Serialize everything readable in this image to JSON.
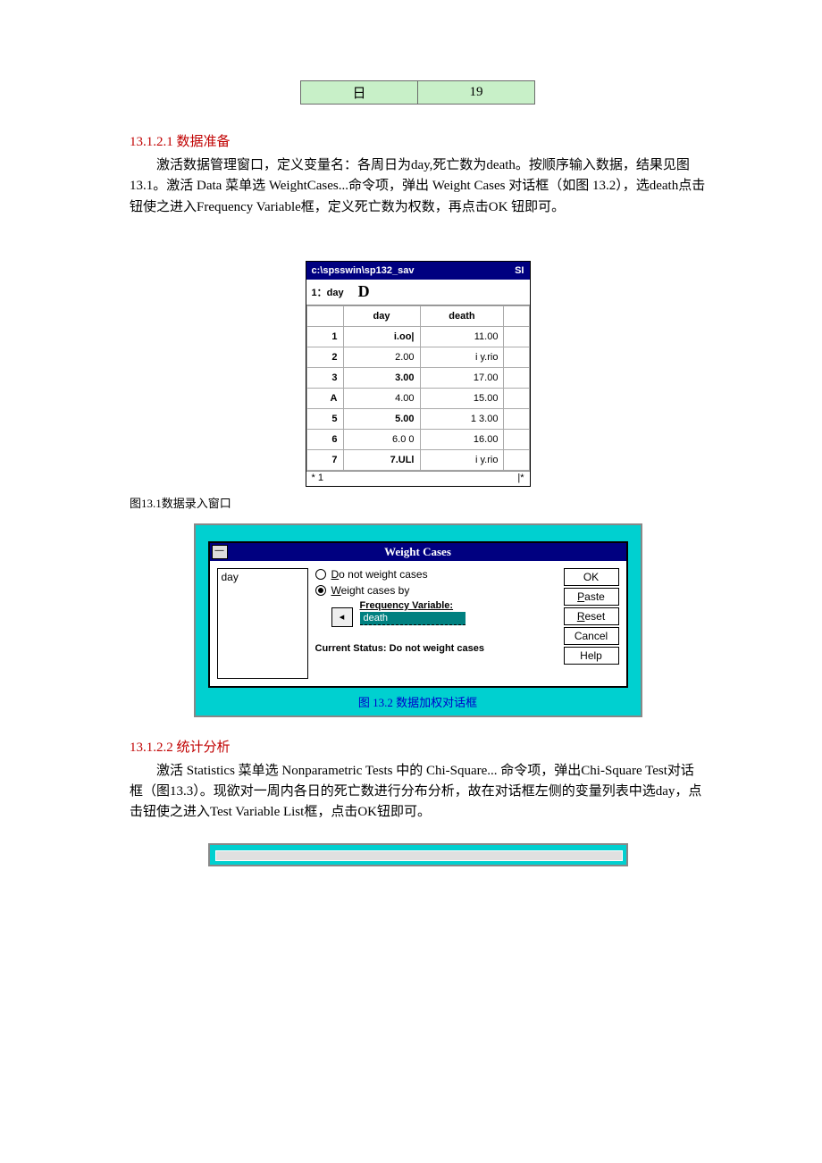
{
  "mini_table": {
    "left": "日",
    "right": "19"
  },
  "sec1": {
    "heading": "13.1.2.1  数据准备",
    "para": "激活数据管理窗口，定义变量名：各周日为day,死亡数为death。按顺序输入数据，结果见图 13.1。激活 Data 菜单选 WeightCases...命令项，弹出 Weight Cases 对话框（如图 13.2），选death点击钮使之进入Frequency Variable框，定义死亡数为权数，再点击OK 钮即可。"
  },
  "spss": {
    "path": "c:\\spsswin\\sp132_sav",
    "tag": "SI",
    "row1_label": "1：day",
    "row1_value": "D",
    "headers": [
      "",
      "day",
      "death",
      ""
    ],
    "rows": [
      {
        "n": "1",
        "day": "i.oo|",
        "death": "11.00"
      },
      {
        "n": "2",
        "day": "2.00",
        "death": "i y.rio"
      },
      {
        "n": "3",
        "day": "3.00",
        "death": "17.00"
      },
      {
        "n": "A",
        "day": "4.00",
        "death": "15.00"
      },
      {
        "n": "5",
        "day": "5.00",
        "death": "1 3.00"
      },
      {
        "n": "6",
        "day": "6.0 0",
        "death": "16.00"
      },
      {
        "n": "7",
        "day": "7.ULl",
        "death": "i y.rio"
      }
    ],
    "footer_left": "*  1",
    "footer_right": "|*"
  },
  "caption1": "图13.1数据录入窗口",
  "dialog": {
    "title": "Weight Cases",
    "varlist": "day",
    "opt1": "Do not weight cases",
    "opt2": "Weight cases by",
    "freq_label": "Frequency Variable:",
    "freq_value": "death",
    "status": "Current Status: Do not weight cases",
    "buttons": [
      "OK",
      "Paste",
      "Reset",
      "Cancel",
      "Help"
    ],
    "arrow": "◂",
    "caption": "图 13.2  数据加权对话框"
  },
  "sec2": {
    "heading": "13.1.2.2  统计分析",
    "para": "激活 Statistics 菜单选 Nonparametric Tests 中的 Chi-Square... 命令项，弹出Chi-Square Test对话框（图13.3）。现欲对一周内各日的死亡数进行分布分析，故在对话框左侧的变量列表中选day，点击钮使之进入Test Variable List框，点击OK钮即可。"
  }
}
